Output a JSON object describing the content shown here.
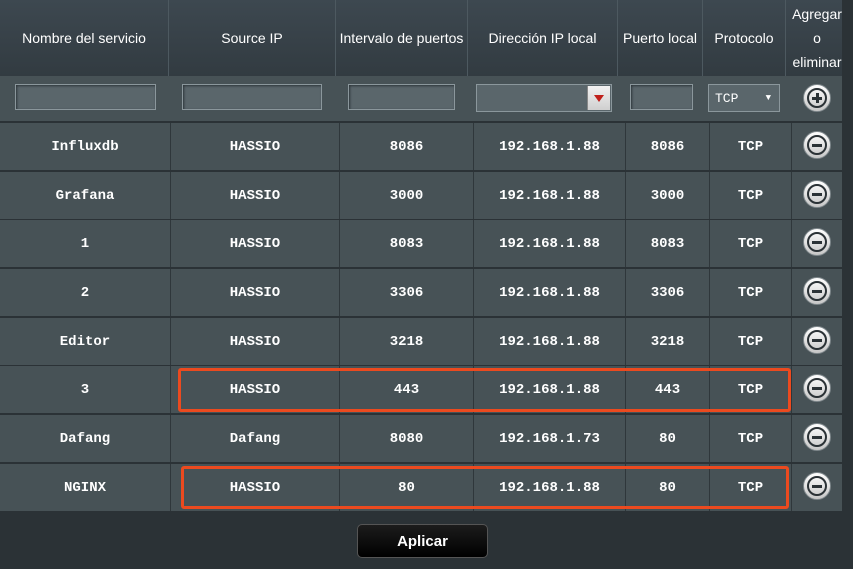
{
  "headers": [
    "Nombre del servicio",
    "Source IP",
    "Intervalo de puertos",
    "Dirección IP local",
    "Puerto local",
    "Protocolo",
    "Agregar o eliminar"
  ],
  "input_row": {
    "service_name": "",
    "source_ip": "",
    "port_range": "",
    "local_ip": "",
    "local_port": "",
    "protocol": "TCP"
  },
  "rows": [
    {
      "name": "Influxdb",
      "source": "HASSIO",
      "ports": "8086",
      "ip": "192.168.1.88",
      "local_port": "8086",
      "protocol": "TCP"
    },
    {
      "name": "Grafana",
      "source": "HASSIO",
      "ports": "3000",
      "ip": "192.168.1.88",
      "local_port": "3000",
      "protocol": "TCP"
    },
    {
      "name": "1",
      "source": "HASSIO",
      "ports": "8083",
      "ip": "192.168.1.88",
      "local_port": "8083",
      "protocol": "TCP"
    },
    {
      "name": "2",
      "source": "HASSIO",
      "ports": "3306",
      "ip": "192.168.1.88",
      "local_port": "3306",
      "protocol": "TCP"
    },
    {
      "name": "Editor",
      "source": "HASSIO",
      "ports": "3218",
      "ip": "192.168.1.88",
      "local_port": "3218",
      "protocol": "TCP"
    },
    {
      "name": "3",
      "source": "HASSIO",
      "ports": "443",
      "ip": "192.168.1.88",
      "local_port": "443",
      "protocol": "TCP"
    },
    {
      "name": "Dafang",
      "source": "Dafang",
      "ports": "8080",
      "ip": "192.168.1.73",
      "local_port": "80",
      "protocol": "TCP"
    },
    {
      "name": "NGINX",
      "source": "HASSIO",
      "ports": "80",
      "ip": "192.168.1.88",
      "local_port": "80",
      "protocol": "TCP"
    }
  ],
  "colors": {
    "highlight": "#ec4a1f",
    "row_bg": "#475256",
    "header_bg": "#3d4850"
  },
  "icons": {
    "add": "plus-circle-icon",
    "remove": "minus-circle-icon",
    "dropdown": "triangle-down-icon"
  },
  "apply_label": "Aplicar"
}
